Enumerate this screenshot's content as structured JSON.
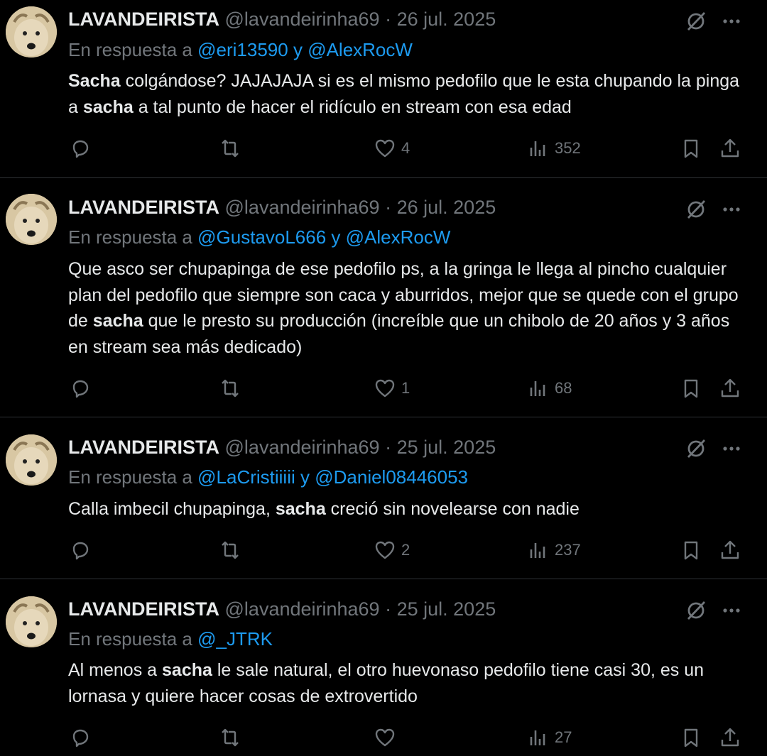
{
  "tweets": [
    {
      "name": "LAVANDEIRISTA",
      "handle": "@lavandeirinha69",
      "separator": "·",
      "date": "26 jul. 2025",
      "reply_prefix": "En respuesta a",
      "mention_1": "@eri13590",
      "reply_joiner": "y",
      "mention_2": "@AlexRocW",
      "body_parts": [
        "Sacha",
        " colgándose? JAJAJAJA si es el mismo pedofilo que le esta chupando la pinga a ",
        "sacha",
        " a tal punto de hacer el ridículo en stream con esa edad"
      ],
      "likes": "4",
      "views": "352"
    },
    {
      "name": "LAVANDEIRISTA",
      "handle": "@lavandeirinha69",
      "separator": "·",
      "date": "26 jul. 2025",
      "reply_prefix": "En respuesta a",
      "mention_1": "@GustavoL666",
      "reply_joiner": "y",
      "mention_2": "@AlexRocW",
      "body_parts": [
        "Que asco ser chupapinga de ese pedofilo ps, a la gringa le llega al pincho cualquier plan del pedofilo que siempre son caca y aburridos, mejor que se quede con el grupo de ",
        "sacha",
        " que le presto su producción (increíble que un chibolo de 20 años y 3 años en stream sea más dedicado)"
      ],
      "likes": "1",
      "views": "68"
    },
    {
      "name": "LAVANDEIRISTA",
      "handle": "@lavandeirinha69",
      "separator": "·",
      "date": "25 jul. 2025",
      "reply_prefix": "En respuesta a",
      "mention_1": "@LaCristiiiii",
      "reply_joiner": "y",
      "mention_2": "@Daniel08446053",
      "body_parts": [
        "Calla imbecil chupapinga, ",
        "sacha",
        " creció sin novelearse con nadie"
      ],
      "likes": "2",
      "views": "237"
    },
    {
      "name": "LAVANDEIRISTA",
      "handle": "@lavandeirinha69",
      "separator": "·",
      "date": "25 jul. 2025",
      "reply_prefix": "En respuesta a",
      "mention_1": "@_JTRK",
      "body_parts": [
        "Al menos a ",
        "sacha",
        " le sale natural, el otro huevonaso pedofilo tiene casi 30, es un lornasa y quiere hacer cosas de extrovertido"
      ],
      "views": "27"
    }
  ],
  "icons": {
    "reply": "reply-icon",
    "retweet": "retweet-icon",
    "like": "heart-icon",
    "views": "views-icon",
    "bookmark": "bookmark-icon",
    "share": "share-icon",
    "grok": "grok-icon",
    "more": "more-icon"
  },
  "colors": {
    "background": "#000000",
    "text": "#e7e9ea",
    "muted": "#71767b",
    "mention": "#1d9bf0",
    "divider": "#2f3336"
  }
}
